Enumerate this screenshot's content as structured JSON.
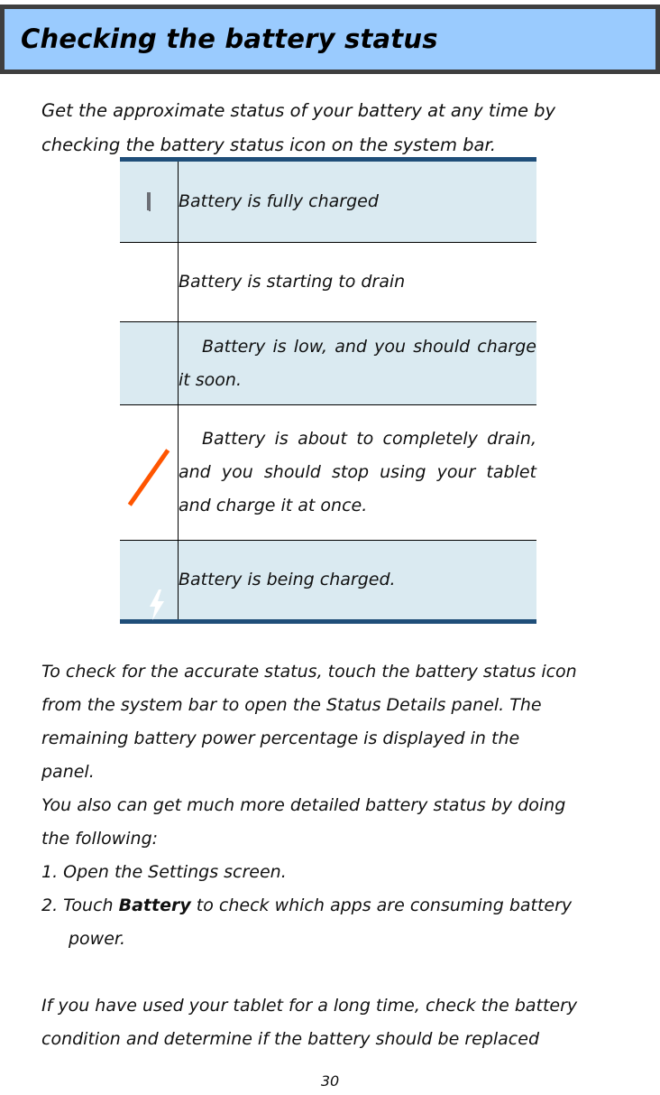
{
  "header": {
    "title": "Checking the battery status",
    "background_color": "#9acbfe",
    "border_color": "#3f3f3f"
  },
  "intro": {
    "line1": "Get the approximate status of your battery at any time by",
    "line2": "checking the battery status icon on the system bar."
  },
  "status_table": {
    "border_color": "#1f4e79",
    "shaded_row_color": "#daeaf1",
    "rows": [
      {
        "icon": "battery-full-icon",
        "description": "Battery is fully charged",
        "shaded": true
      },
      {
        "icon": "battery-high-icon",
        "description": "Battery is starting to drain",
        "shaded": false
      },
      {
        "icon": "battery-low-icon",
        "description": "Battery is low, and you should charge it soon.",
        "shaded": true
      },
      {
        "icon": "battery-critical-icon",
        "description": "Battery is about to completely drain, and you should stop using your tablet and charge it at once.",
        "shaded": false
      },
      {
        "icon": "battery-charging-icon",
        "description": "Battery is being charged.",
        "shaded": true
      }
    ]
  },
  "body": {
    "para1_line1": "To check for the accurate status, touch the battery status icon",
    "para1_line2": "from the system bar to open the Status Details panel. The",
    "para1_line3": "remaining battery power percentage is displayed in the",
    "para1_line4": "panel.",
    "para2_line1": "You also can get much more detailed battery status by doing",
    "para2_line2": "the following:",
    "step1": "1. Open the Settings screen.",
    "step2_pre": "2. Touch ",
    "step2_bold": "Battery",
    "step2_post": " to check which apps are consuming battery",
    "step2_cont": "power.",
    "para3_line1": "If you have used your tablet for a long time, check the battery",
    "para3_line2": "condition and determine if the battery should be replaced"
  },
  "page_number": "30"
}
